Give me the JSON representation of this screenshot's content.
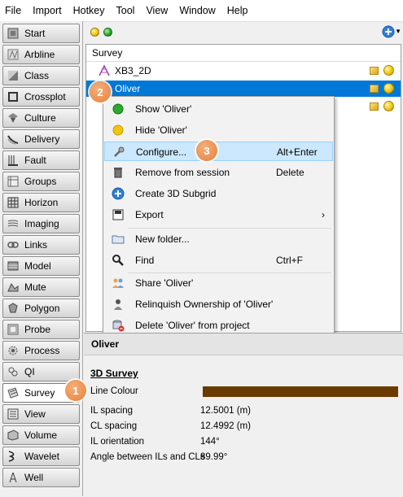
{
  "menubar": [
    "File",
    "Import",
    "Hotkey",
    "Tool",
    "View",
    "Window",
    "Help"
  ],
  "sidebar": {
    "items": [
      {
        "label": "Start",
        "icon": "start-icon"
      },
      {
        "label": "Arbline",
        "icon": "arbline-icon"
      },
      {
        "label": "Class",
        "icon": "class-icon"
      },
      {
        "label": "Crossplot",
        "icon": "crossplot-icon"
      },
      {
        "label": "Culture",
        "icon": "culture-icon"
      },
      {
        "label": "Delivery",
        "icon": "delivery-icon"
      },
      {
        "label": "Fault",
        "icon": "fault-icon"
      },
      {
        "label": "Groups",
        "icon": "groups-icon"
      },
      {
        "label": "Horizon",
        "icon": "horizon-icon"
      },
      {
        "label": "Imaging",
        "icon": "imaging-icon"
      },
      {
        "label": "Links",
        "icon": "links-icon"
      },
      {
        "label": "Model",
        "icon": "model-icon"
      },
      {
        "label": "Mute",
        "icon": "mute-icon"
      },
      {
        "label": "Polygon",
        "icon": "polygon-icon"
      },
      {
        "label": "Probe",
        "icon": "probe-icon"
      },
      {
        "label": "Process",
        "icon": "process-icon"
      },
      {
        "label": "QI",
        "icon": "qi-icon"
      },
      {
        "label": "Survey",
        "icon": "survey-icon",
        "active": true
      },
      {
        "label": "View",
        "icon": "view-icon"
      },
      {
        "label": "Volume",
        "icon": "volume-icon"
      },
      {
        "label": "Wavelet",
        "icon": "wavelet-icon"
      },
      {
        "label": "Well",
        "icon": "well-icon"
      }
    ]
  },
  "list": {
    "header": "Survey",
    "rows": [
      {
        "name": "XB3_2D"
      },
      {
        "name": "Oliver"
      },
      {
        "name": ""
      }
    ]
  },
  "context_menu": [
    {
      "label": "Show 'Oliver'",
      "shortcut": "",
      "icon": "green-dot-icon"
    },
    {
      "label": "Hide 'Oliver'",
      "shortcut": "",
      "icon": "yellow-dot-icon"
    },
    {
      "label": "Configure...",
      "shortcut": "Alt+Enter",
      "icon": "wrench-icon",
      "highlighted": true
    },
    {
      "label": "Remove from session",
      "shortcut": "Delete",
      "icon": "trash-icon"
    },
    {
      "label": "Create 3D Subgrid",
      "shortcut": "",
      "icon": "plus-circle-icon"
    },
    {
      "label": "Export",
      "shortcut": "",
      "icon": "export-icon",
      "submenu": true
    },
    {
      "label": "New folder...",
      "shortcut": "",
      "icon": "folder-icon"
    },
    {
      "label": "Find",
      "shortcut": "Ctrl+F",
      "icon": "magnifier-icon"
    },
    {
      "label": "Share 'Oliver'",
      "shortcut": "",
      "icon": "share-users-icon"
    },
    {
      "label": "Relinquish Ownership of 'Oliver'",
      "shortcut": "",
      "icon": "user-icon"
    },
    {
      "label": "Delete 'Oliver' from project",
      "shortcut": "",
      "icon": "delete-db-icon"
    }
  ],
  "details": {
    "title": "Oliver",
    "section": "3D Survey",
    "line_colour_label": "Line Colour",
    "line_colour": "#6b3a00",
    "props": [
      {
        "label": "IL spacing",
        "value": "12.5001 (m)"
      },
      {
        "label": "CL spacing",
        "value": "12.4992 (m)"
      },
      {
        "label": "IL orientation",
        "value": "144°"
      },
      {
        "label": "Angle between ILs and CLs",
        "value": "89.99°"
      }
    ]
  },
  "badges": [
    "1",
    "2",
    "3"
  ],
  "colors": {
    "accent": "#0078d7",
    "badge": "#e8803c",
    "highlight": "#cce8ff"
  }
}
